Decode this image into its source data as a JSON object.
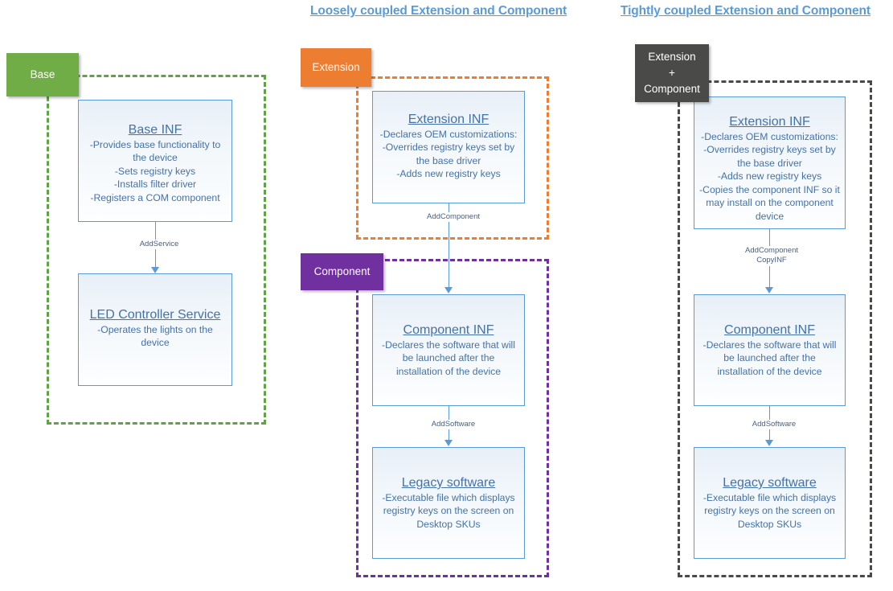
{
  "columns": {
    "left": {
      "title": ""
    },
    "middle": {
      "title": "Loosely coupled Extension and Component"
    },
    "right": {
      "title": "Tightly coupled Extension and Component"
    }
  },
  "colors": {
    "base_green": "#70AD47",
    "extension_orange": "#ED7D31",
    "component_purple": "#7030A0",
    "combined_gray": "#4A4A48",
    "card_border_blue": "#5B9BD5",
    "text_blue": "#4472A8",
    "title_blue": "#5B9BD5"
  },
  "chips": {
    "base": "Base",
    "extension": "Extension",
    "component": "Component",
    "combined_line1": "Extension",
    "combined_line2": "+",
    "combined_line3": "Component"
  },
  "cards": {
    "base_inf": {
      "title": "Base INF",
      "lines": [
        "-Provides base functionality to",
        "the device",
        "-Sets registry keys",
        "-Installs filter driver",
        "-Registers a COM component"
      ]
    },
    "led_service": {
      "title": "LED Controller Service",
      "lines": [
        "-Operates the lights on the",
        "device"
      ]
    },
    "extension_inf_loose": {
      "title": "Extension INF",
      "lines": [
        "-Declares OEM customizations:",
        "-Overrides registry keys set by",
        "the base driver",
        "-Adds new registry keys"
      ]
    },
    "component_inf_loose": {
      "title": "Component INF",
      "lines": [
        "-Declares the software that will",
        "be launched after the",
        "installation of the device"
      ]
    },
    "legacy_software_loose": {
      "title": "Legacy software",
      "lines": [
        "-Executable file which displays",
        "registry keys on the screen on",
        "Desktop SKUs"
      ]
    },
    "extension_inf_tight": {
      "title": "Extension INF",
      "lines": [
        "-Declares OEM customizations:",
        "-Overrides registry keys set by",
        "the base driver",
        "-Adds new registry keys",
        "-Copies the component INF so it",
        "may install on the component",
        "device"
      ]
    },
    "component_inf_tight": {
      "title": "Component INF",
      "lines": [
        "-Declares the software that will",
        "be launched after the",
        "installation of the device"
      ]
    },
    "legacy_software_tight": {
      "title": "Legacy software",
      "lines": [
        "-Executable file which displays",
        "registry keys on the screen on",
        "Desktop SKUs"
      ]
    }
  },
  "connectors": {
    "add_service": "AddService",
    "add_component_loose": "AddComponent",
    "add_software_loose": "AddSoftware",
    "add_component_tight_line1": "AddComponent",
    "add_component_tight_line2": "CopyINF",
    "add_software_tight": "AddSoftware"
  }
}
